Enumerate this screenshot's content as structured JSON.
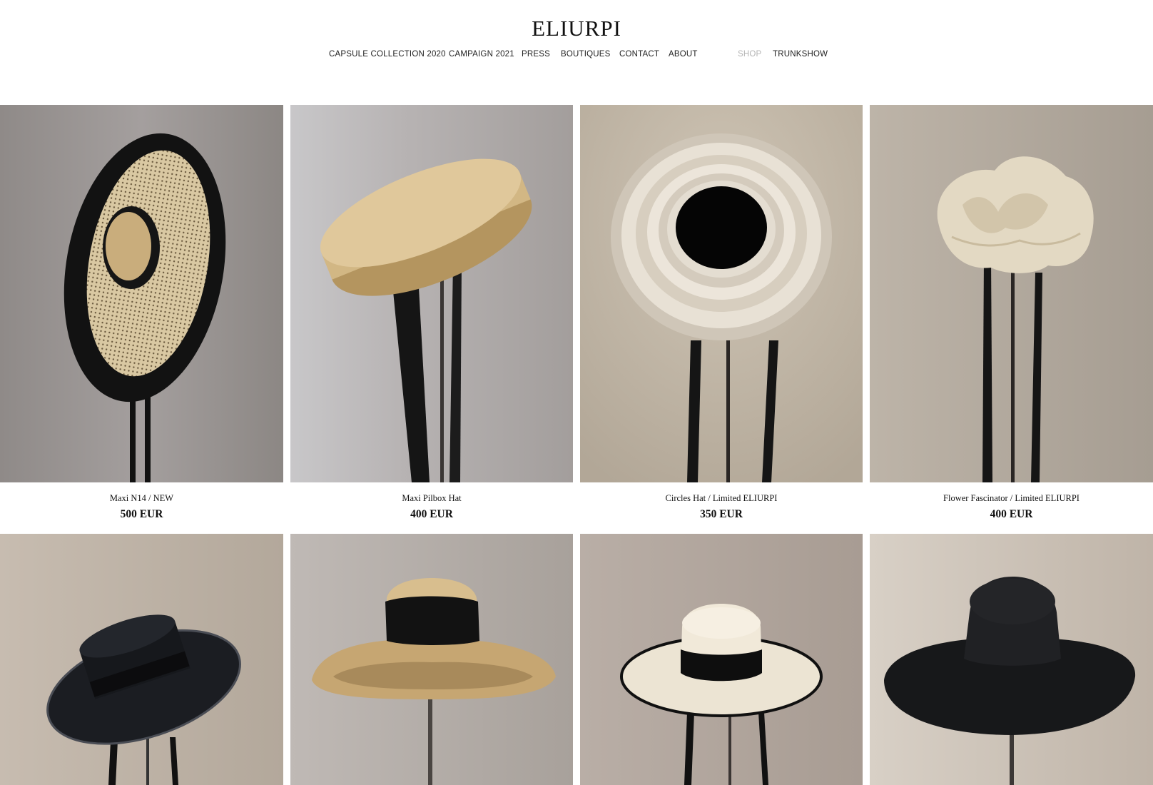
{
  "brand": {
    "name": "ELIURPI"
  },
  "nav": {
    "items": [
      {
        "label": "CAPSULE COLLECTION 2020"
      },
      {
        "label": "CAMPAIGN 2021"
      },
      {
        "label": "PRESS"
      },
      {
        "label": "BOUTIQUES"
      },
      {
        "label": "CONTACT"
      },
      {
        "label": "ABOUT"
      },
      {
        "label": "SHOP",
        "active": true
      },
      {
        "label": "TRUNKSHOW"
      }
    ]
  },
  "products": [
    {
      "name": "Maxi N14 / NEW",
      "price": "500 EUR",
      "image": "hat-cane-black-brim"
    },
    {
      "name": "Maxi Pilbox Hat",
      "price": "400 EUR",
      "image": "hat-straw-pillbox"
    },
    {
      "name": "Circles Hat / Limited ELIURPI",
      "price": "350 EUR",
      "image": "hat-cream-circles"
    },
    {
      "name": "Flower Fascinator / Limited ELIURPI",
      "price": "400 EUR",
      "image": "hat-cream-flower"
    },
    {
      "image": "hat-black-boater"
    },
    {
      "image": "hat-straw-wide-ribbon"
    },
    {
      "image": "hat-cream-boater"
    },
    {
      "image": "hat-black-wide-straw"
    }
  ],
  "colors": {
    "text": "#111111",
    "nav_muted": "#b4b4b4",
    "background": "#ffffff"
  }
}
